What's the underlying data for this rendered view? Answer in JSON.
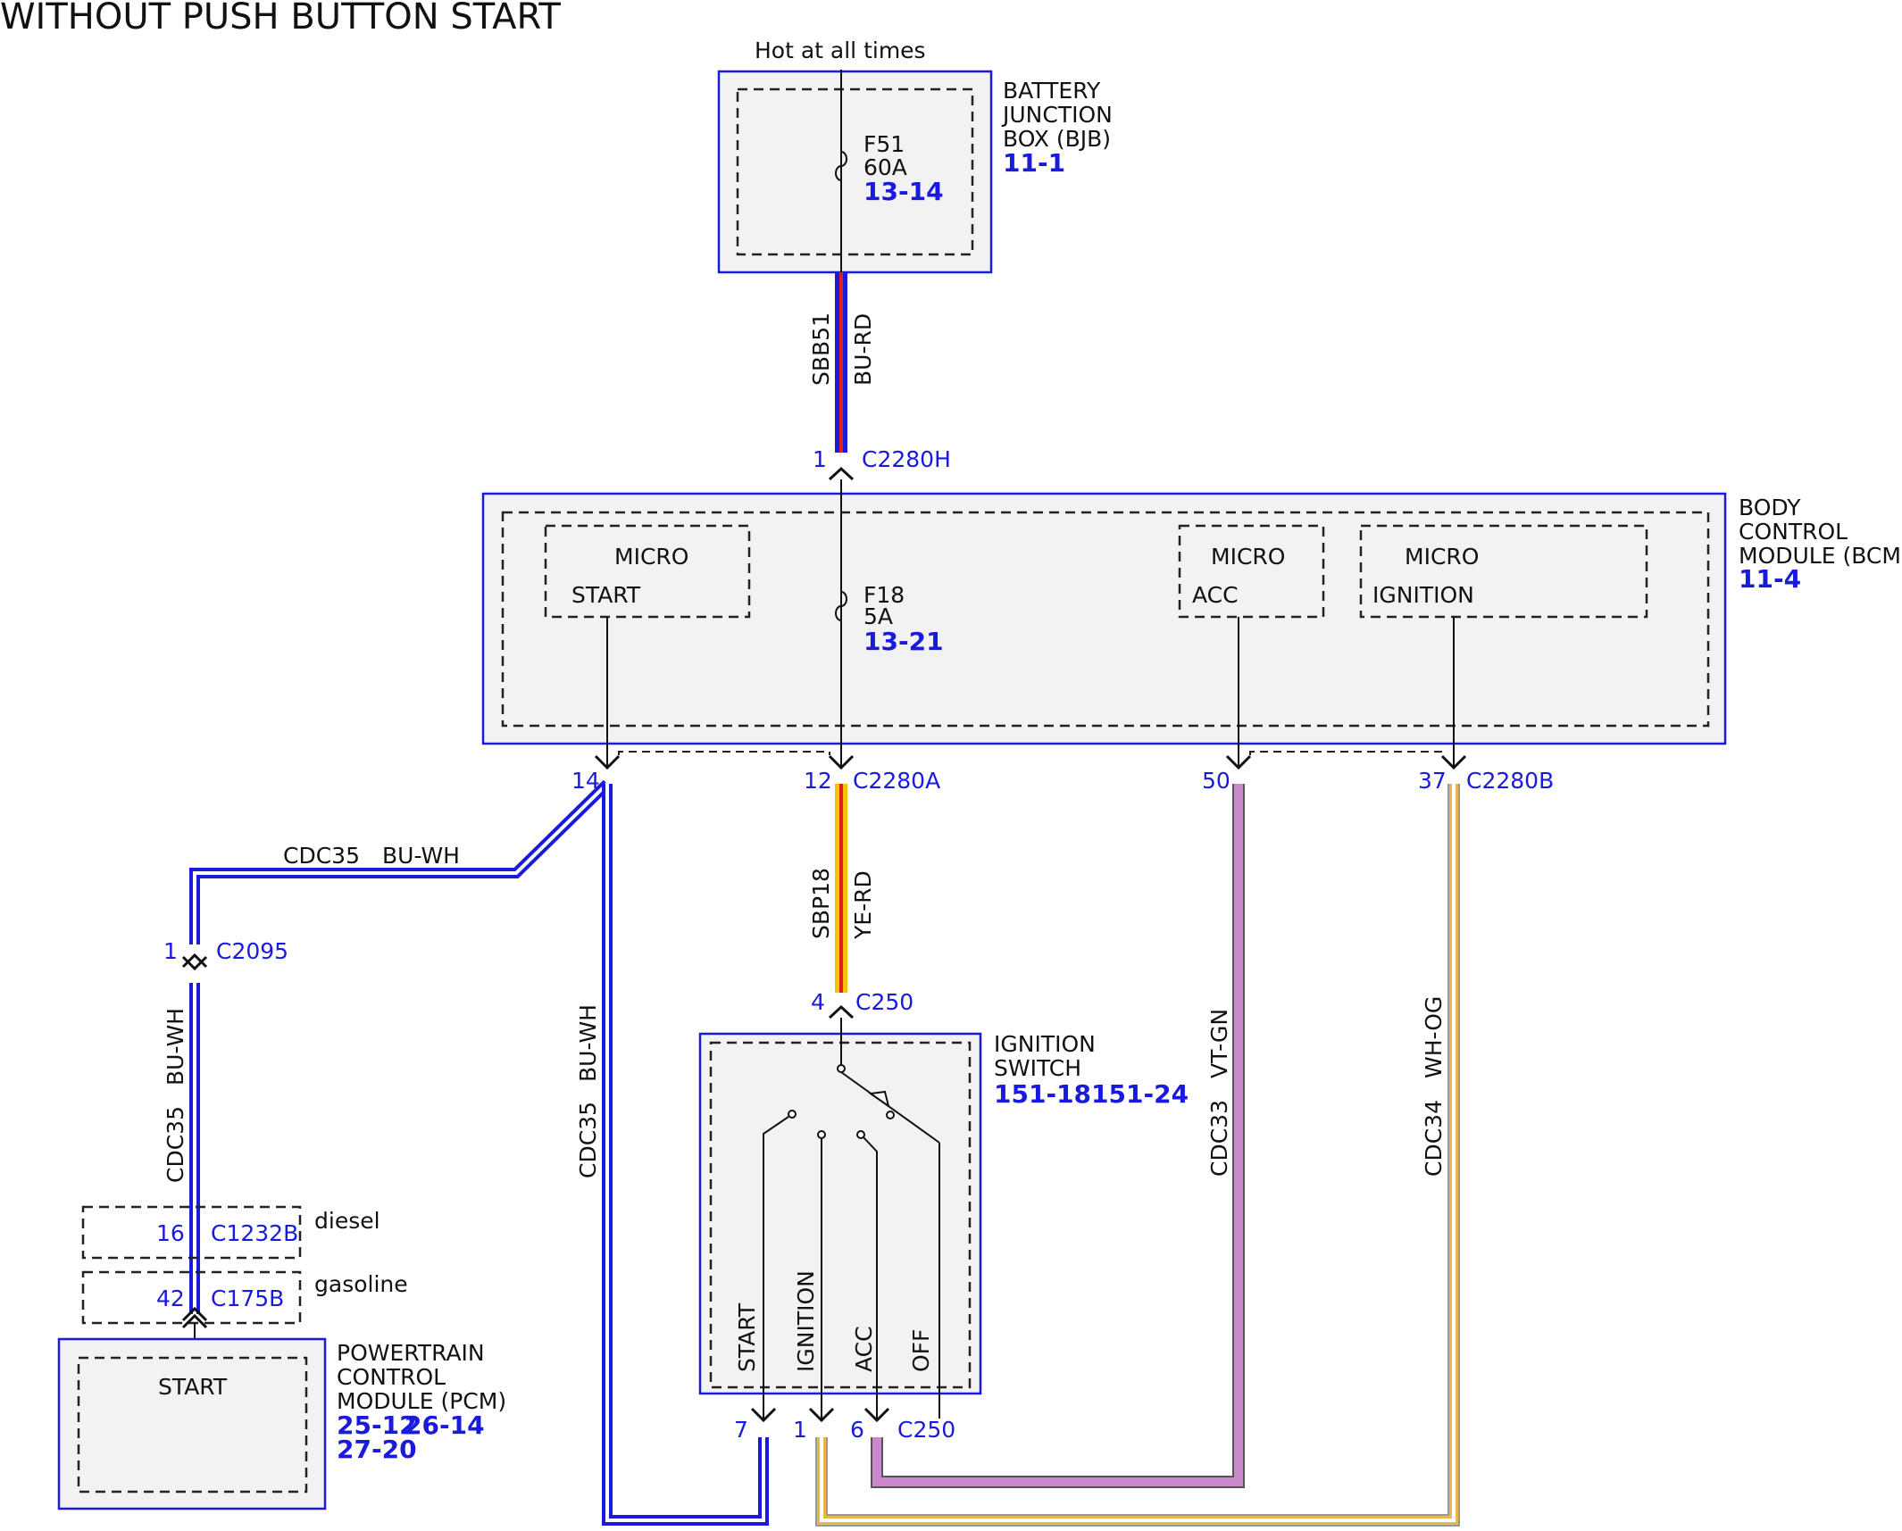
{
  "title": "WITHOUT PUSH BUTTON START",
  "hot_label": "Hot at all times",
  "bjb": {
    "name_lines": [
      "BATTERY",
      "JUNCTION",
      "BOX (BJB)"
    ],
    "ref": "11-1",
    "fuse_id": "F51",
    "fuse_rating": "60A",
    "fuse_ref": "13-14"
  },
  "wire_sbb51": {
    "circuit": "SBB51",
    "color": "BU-RD"
  },
  "bcm": {
    "name_lines": [
      "BODY",
      "CONTROL",
      "MODULE (BCM)"
    ],
    "ref": "11-4",
    "in_pin": "1",
    "in_connector": "C2280H",
    "micro_label": "MICRO",
    "micro_start": "START",
    "micro_acc": "ACC",
    "micro_ignition": "IGNITION",
    "fuse_id": "F18",
    "fuse_rating": "5A",
    "fuse_ref": "13-21",
    "pin_start": "14",
    "pin_fuse": "12",
    "connector_a": "C2280A",
    "pin_acc": "50",
    "pin_ign": "37",
    "connector_b": "C2280B"
  },
  "wire_cdc35": {
    "circuit": "CDC35",
    "color": "BU-WH"
  },
  "wire_sbp18": {
    "circuit": "SBP18",
    "color": "YE-RD"
  },
  "wire_cdc33": {
    "circuit": "CDC33",
    "color": "VT-GN"
  },
  "wire_cdc34": {
    "circuit": "CDC34",
    "color": "WH-OG"
  },
  "c2095": {
    "pin": "1",
    "connector": "C2095"
  },
  "c1232b": {
    "pin": "16",
    "connector": "C1232B",
    "variant": "diesel"
  },
  "c175b": {
    "pin": "42",
    "connector": "C175B",
    "variant": "gasoline"
  },
  "pcm": {
    "name_lines": [
      "POWERTRAIN",
      "CONTROL",
      "MODULE (PCM)"
    ],
    "refs": [
      "25-12",
      "26-14",
      "27-20"
    ],
    "internal": "START"
  },
  "ignition_switch": {
    "name_lines": [
      "IGNITION",
      "SWITCH"
    ],
    "refs": "151-18151-24",
    "in_pin": "4",
    "in_connector": "C250",
    "positions": [
      "START",
      "IGNITION",
      "ACC",
      "OFF"
    ],
    "out_pins": [
      "7",
      "1",
      "6"
    ],
    "out_connector": "C250"
  },
  "colors": {
    "box_border": "#1a1adc",
    "box_fill": "#f2f2f2",
    "text_blue": "#1a1adc",
    "bu_wh": "#1a1adc",
    "bu_rd_stripe": "#dd2222",
    "ye_rd": "#f5c400",
    "vt_gn": "#cc88cc",
    "wh_og": "#e8b84a"
  }
}
